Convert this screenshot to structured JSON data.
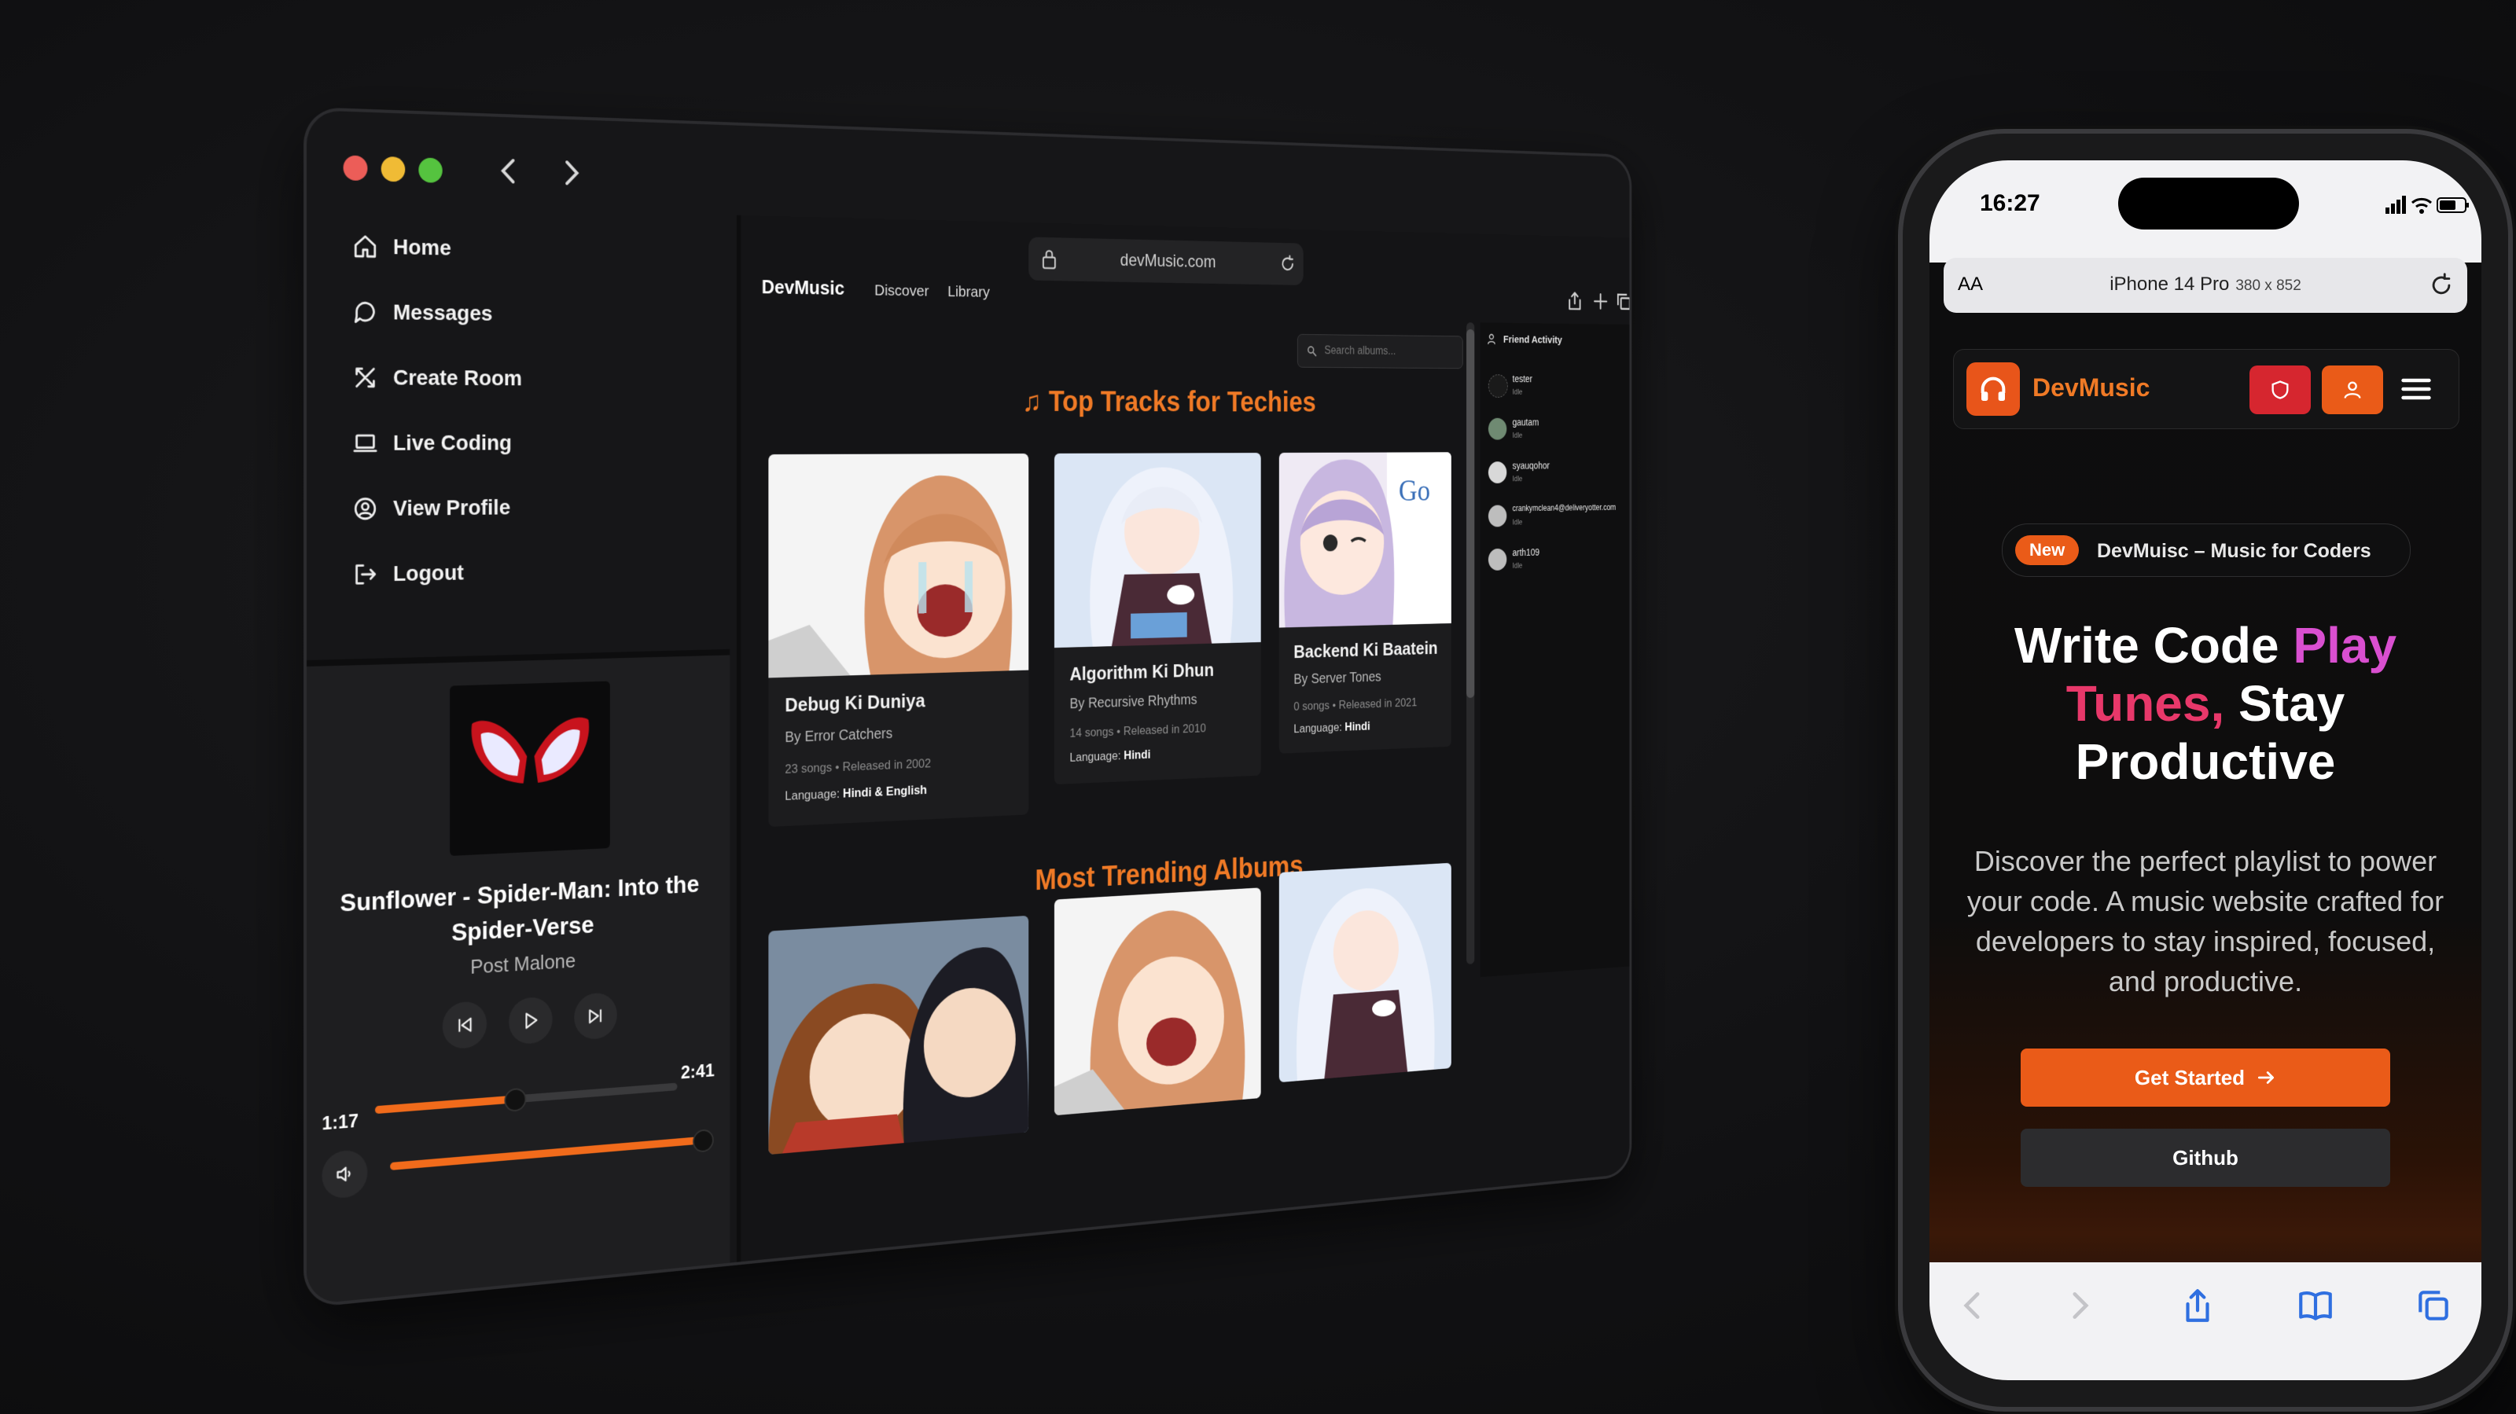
{
  "desktop": {
    "sidebar": {
      "items": [
        {
          "label": "Home",
          "icon": "home-icon"
        },
        {
          "label": "Messages",
          "icon": "message-icon"
        },
        {
          "label": "Create Room",
          "icon": "tools-icon"
        },
        {
          "label": "Live Coding",
          "icon": "laptop-icon"
        },
        {
          "label": "View Profile",
          "icon": "profile-icon"
        },
        {
          "label": "Logout",
          "icon": "logout-icon"
        }
      ]
    },
    "player": {
      "title": "Sunflower - Spider-Man: Into the Spider-Verse",
      "artist": "Post Malone",
      "current_time": "1:17",
      "total_time": "2:41",
      "progress": 0.45,
      "volume": 1.0
    },
    "browser": {
      "url": "devMusic.com",
      "brand": "DevMusic",
      "nav": [
        "Discover",
        "Library"
      ],
      "search_placeholder": "Search albums...",
      "top_tracks_title": "Top Tracks for Techies",
      "trending_title": "Most Trending Albums",
      "tracks": [
        {
          "title": "Debug Ki Duniya",
          "by": "By Error Catchers",
          "meta": "23 songs • Released in 2002",
          "lang_label": "Language:",
          "lang": "Hindi & English"
        },
        {
          "title": "Algorithm Ki Dhun",
          "by": "By Recursive Rhythms",
          "meta": "14 songs • Released in 2010",
          "lang_label": "Language:",
          "lang": "Hindi"
        },
        {
          "title": "Backend Ki Baatein",
          "by": "By Server Tones",
          "meta": "0 songs • Released in 2021",
          "lang_label": "Language:",
          "lang": "Hindi"
        }
      ],
      "friend_activity": {
        "title": "Friend Activity",
        "friends": [
          {
            "name": "tester",
            "status": "Idle"
          },
          {
            "name": "gautam",
            "status": "Idle"
          },
          {
            "name": "syauqohor",
            "status": "Idle"
          },
          {
            "name": "crankymclean4@deliveryotter.com",
            "status": "Idle"
          },
          {
            "name": "arth109",
            "status": "Idle"
          }
        ]
      }
    }
  },
  "phone": {
    "time": "16:27",
    "address": "iPhone 14 Pro",
    "address_size": "380 x 852",
    "aa": "AA",
    "brand": "DevMusic",
    "badge_new": "New",
    "badge_text": "DevMuisc – Music for Coders",
    "hero": {
      "w1": "Write Code",
      "w2": "Play",
      "w3": "Tunes,",
      "w4": "Stay",
      "w5": "Productive"
    },
    "subtitle": "Discover the perfect playlist to power your code. A music website crafted for developers to stay inspired, focused, and productive.",
    "cta_primary": "Get Started",
    "cta_secondary": "Github"
  },
  "colors": {
    "accent": "#ea5b18",
    "title_orange": "#f07a26",
    "pink": "#d94fd0",
    "red": "#e8386a"
  }
}
